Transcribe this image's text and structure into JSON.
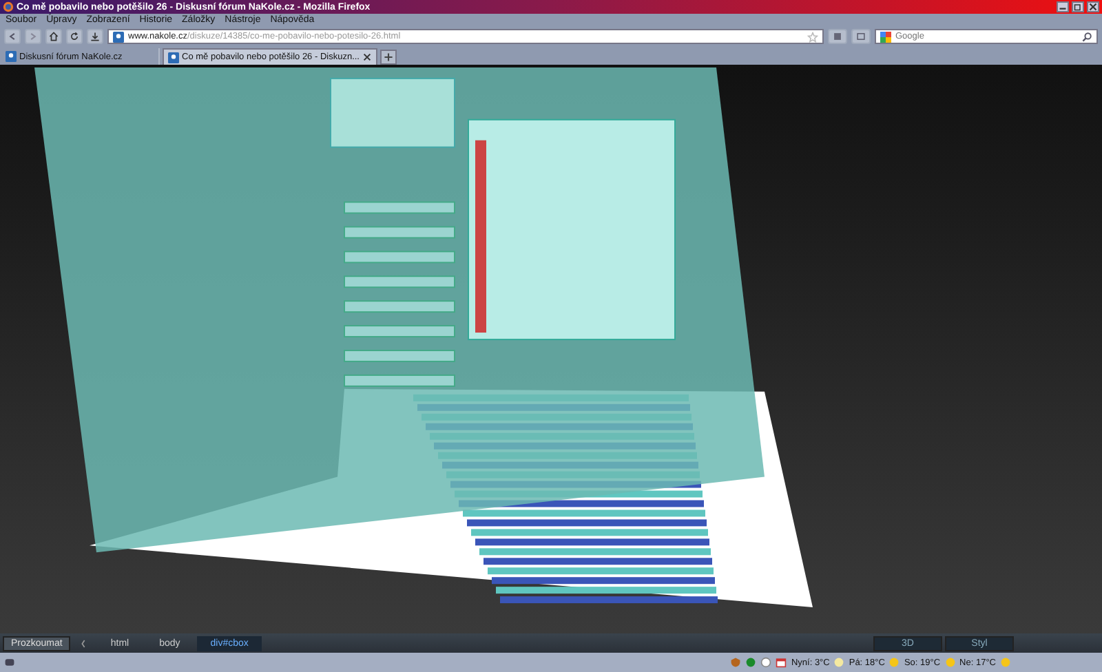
{
  "window": {
    "title": "Co mě pobavilo nebo potěšilo 26 - Diskusní fórum NaKole.cz - Mozilla Firefox"
  },
  "menu": [
    "Soubor",
    "Úpravy",
    "Zobrazení",
    "Historie",
    "Záložky",
    "Nástroje",
    "Nápověda"
  ],
  "address_bar": {
    "domain": "www.nakole.cz",
    "path": "/diskuze/14385/co-me-pobavilo-nebo-potesilo-26.html"
  },
  "search": {
    "placeholder": "Google"
  },
  "tabs": [
    {
      "label": "Diskusní fórum NaKole.cz",
      "selected": false
    },
    {
      "label": "Co mě pobavilo nebo potěšilo 26 - Diskuzn...",
      "selected": true
    }
  ],
  "inspector": {
    "inspect_button": "Prozkoumat",
    "breadcrumbs": [
      {
        "label": "html",
        "selected": false
      },
      {
        "label": "body",
        "selected": false
      },
      {
        "label": "div#cbox",
        "selected": true
      }
    ],
    "view_button": "3D",
    "style_button": "Styl"
  },
  "status_bar": {
    "weather": [
      {
        "label": "Nyní: 3°C",
        "kind": "night"
      },
      {
        "label": "Pá: 18°C",
        "kind": "day"
      },
      {
        "label": "So: 19°C",
        "kind": "day"
      },
      {
        "label": "Ne: 17°C",
        "kind": "day"
      }
    ]
  }
}
